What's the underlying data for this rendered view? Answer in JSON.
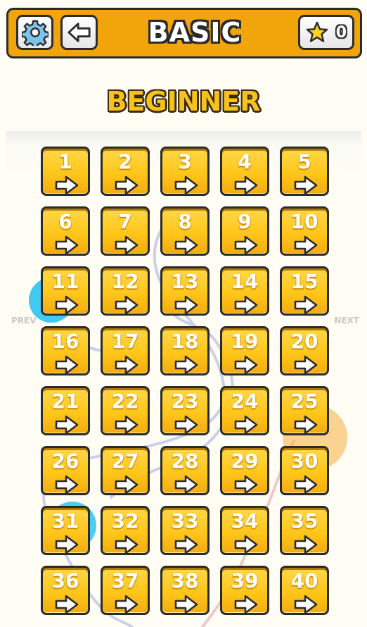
{
  "header": {
    "title": "BASIC",
    "stars_count": "0",
    "settings_icon": "gear-icon",
    "back_icon": "back-arrow-icon",
    "star_icon": "star-icon"
  },
  "pack_title": "BEGINNER",
  "nav": {
    "prev": "PREV",
    "next": "NEXT"
  },
  "levels": [
    "1",
    "2",
    "3",
    "4",
    "5",
    "6",
    "7",
    "8",
    "9",
    "10",
    "11",
    "12",
    "13",
    "14",
    "15",
    "16",
    "17",
    "18",
    "19",
    "20",
    "21",
    "22",
    "23",
    "24",
    "25",
    "26",
    "27",
    "28",
    "29",
    "30",
    "31",
    "32",
    "33",
    "34",
    "35",
    "36",
    "37",
    "38",
    "39",
    "40"
  ],
  "colors": {
    "header_bg": "#f2a50b",
    "tile_yellow": "#ffc61a",
    "outline": "#2b2b2b",
    "page_bg": "#fffdf4"
  }
}
